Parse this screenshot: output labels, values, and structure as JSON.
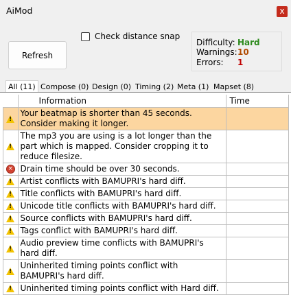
{
  "window": {
    "title": "AiMod",
    "close_glyph": "x"
  },
  "toolbar": {
    "refresh_label": "Refresh",
    "check_distance_snap_label": "Check distance snap",
    "check_distance_snap_checked": false
  },
  "stats": {
    "difficulty_label": "Difficulty:",
    "difficulty_value": "Hard",
    "warnings_label": "Warnings:",
    "warnings_value": "10",
    "errors_label": "Errors:",
    "errors_value": "1",
    "colors": {
      "difficulty": "#2e8b1e",
      "warnings": "#b04a00",
      "errors": "#c00000"
    }
  },
  "tabs": [
    {
      "label": "All (11)",
      "active": true
    },
    {
      "label": "Compose (0)",
      "active": false
    },
    {
      "label": "Design (0)",
      "active": false
    },
    {
      "label": "Timing (2)",
      "active": false
    },
    {
      "label": "Meta (1)",
      "active": false
    },
    {
      "label": "Mapset (8)",
      "active": false
    }
  ],
  "table": {
    "columns": [
      "Information",
      "Time"
    ],
    "rows": [
      {
        "icon": "warning-icon",
        "info": "Your beatmap is shorter than 45 seconds. Consider making it longer.",
        "time": "",
        "selected": true
      },
      {
        "icon": "warning-icon",
        "info": "The mp3 you are using is a lot longer than the part which is mapped.  Consider cropping it to reduce filesize.",
        "time": ""
      },
      {
        "icon": "error-icon",
        "info": "Drain time should be over 30 seconds.",
        "time": ""
      },
      {
        "icon": "warning-icon",
        "info": "Artist conflicts with BAMUPRI's hard diff.",
        "time": ""
      },
      {
        "icon": "warning-icon",
        "info": "Title conflicts with BAMUPRI's hard diff.",
        "time": ""
      },
      {
        "icon": "warning-icon",
        "info": "Unicode title conflicts with BAMUPRI's hard diff.",
        "time": ""
      },
      {
        "icon": "warning-icon",
        "info": "Source conflicts with BAMUPRI's hard diff.",
        "time": ""
      },
      {
        "icon": "warning-icon",
        "info": "Tags conflict with BAMUPRI's hard diff.",
        "time": ""
      },
      {
        "icon": "warning-icon",
        "info": "Audio preview time conflicts with BAMUPRI's hard diff.",
        "time": ""
      },
      {
        "icon": "warning-icon",
        "info": "Uninherited timing points conflict with BAMUPRI's hard diff.",
        "time": ""
      },
      {
        "icon": "warning-icon",
        "info": "Uninherited timing points conflict with Hard diff.",
        "time": ""
      }
    ]
  }
}
